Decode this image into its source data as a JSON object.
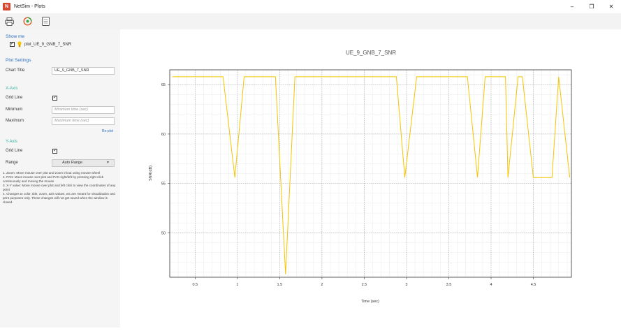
{
  "window": {
    "title": "NetSim - Plots",
    "app_icon_letter": "N"
  },
  "toolbar": {
    "buttons": [
      "print-icon",
      "refresh-icon",
      "document-icon"
    ]
  },
  "sidebar": {
    "show_me_label": "Show me",
    "plot_name": "plot_UE_9_GNB_7_SNR",
    "plot_settings_label": "Plot Settings",
    "chart_title_label": "Chart Title",
    "chart_title_value": "UE_9_GNB_7_SNR",
    "x_axis_label": "X-Axis",
    "x_grid_line_label": "Grid Line",
    "minimum_label": "Minimum",
    "minimum_placeholder": "Minimum time (sec)",
    "maximum_label": "Maximum",
    "maximum_placeholder": "Maximum time (sec)",
    "replot_label": "Re-plot",
    "y_axis_label": "Y-Axis",
    "y_grid_line_label": "Grid Line",
    "range_label": "Range",
    "range_value": "Auto Range",
    "help": [
      "1. Zoom: Move mouse over plot and zoom in/out using mouse wheel",
      "2. PAN: Move mouse over plot and PAN right/left by pressing right click continuously and moving the mouse",
      "3. X-Y value: Move mouse over plot and left click to view the coordinates of any point",
      "4. Changes to color, title, zoom, axis values, etc are meant for visualization and print purposes only. These changes will not get saved when the window is closed."
    ]
  },
  "chart_data": {
    "type": "line",
    "title": "UE_9_GNB_7_SNR",
    "xlabel": "Time (sec)",
    "ylabel": "SNR(dB)",
    "xlim": [
      0.2,
      4.95
    ],
    "ylim": [
      45.5,
      66.5
    ],
    "xticks": [
      0.5,
      1,
      1.5,
      2,
      2.5,
      3,
      3.5,
      4,
      4.5
    ],
    "xtick_labels": [
      "0.5",
      "1",
      "1.5",
      "2",
      "2.5",
      "3",
      "3.5",
      "4",
      "4.5"
    ],
    "yticks": [
      50,
      55,
      60,
      65
    ],
    "ytick_labels": [
      "50",
      "55",
      "60",
      "65"
    ],
    "grid": true,
    "line_color": "#f5c400",
    "series": [
      {
        "x": [
          0.23,
          0.83,
          0.97,
          1.08,
          1.45,
          1.57,
          1.68,
          2.88,
          2.98,
          3.12,
          3.72,
          3.84,
          3.93,
          4.17,
          4.2,
          4.32,
          4.37,
          4.5,
          4.58,
          4.72,
          4.8,
          4.93
        ],
        "y": [
          65.8,
          65.8,
          55.6,
          65.8,
          65.8,
          45.8,
          65.8,
          65.8,
          55.6,
          65.8,
          65.8,
          55.6,
          65.8,
          65.8,
          55.6,
          65.8,
          65.8,
          55.6,
          55.6,
          55.6,
          65.8,
          55.6
        ]
      }
    ]
  }
}
